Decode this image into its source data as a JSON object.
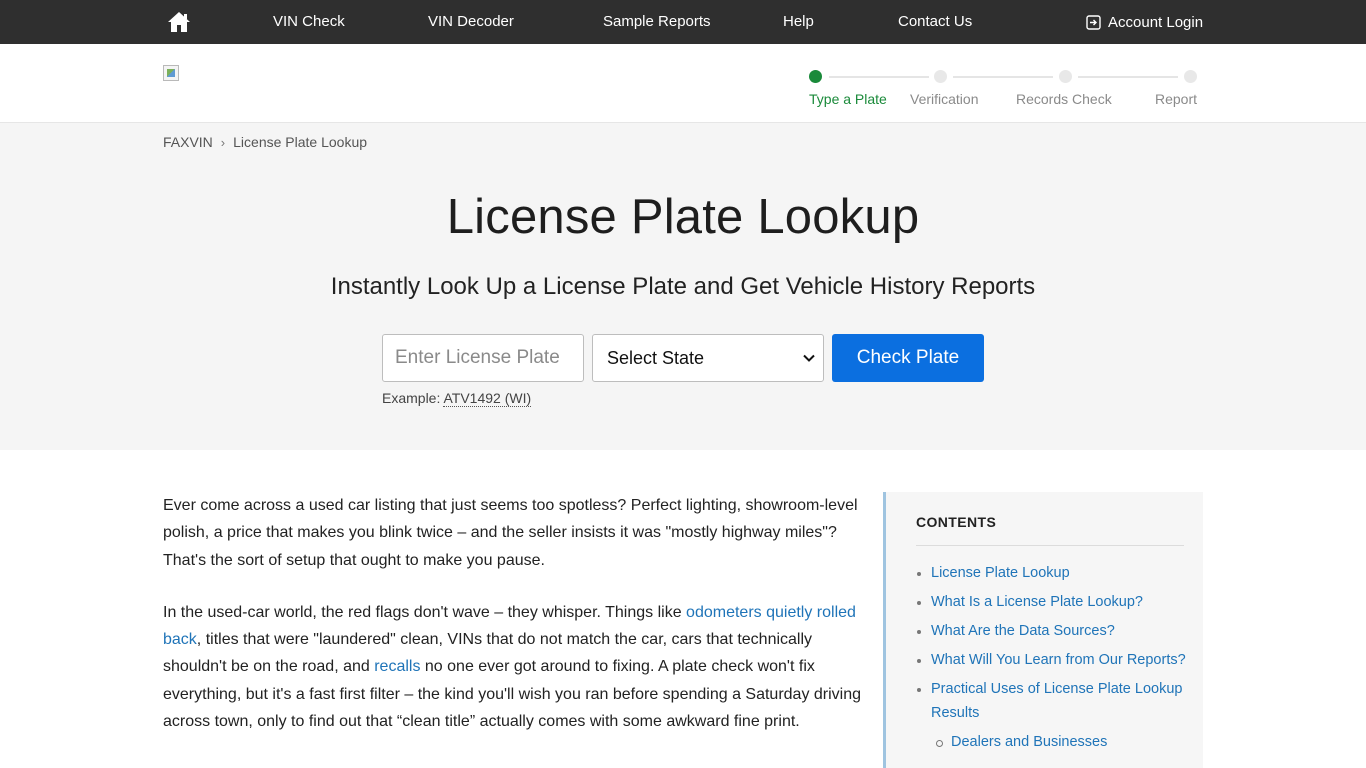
{
  "topnav": {
    "home_icon": "home-icon",
    "links": [
      "VIN Check",
      "VIN Decoder",
      "Sample Reports",
      "Help",
      "Contact Us"
    ],
    "login_icon": "login-icon",
    "login_label": "Account Login"
  },
  "header": {
    "logo_icon": "broken-image-icon",
    "steps": [
      {
        "label": "Type a Plate",
        "active": true
      },
      {
        "label": "Verification",
        "active": false
      },
      {
        "label": "Records Check",
        "active": false
      },
      {
        "label": "Report",
        "active": false
      }
    ],
    "active_color": "#1a8a3a"
  },
  "breadcrumb": {
    "items": [
      "FAXVIN",
      "License Plate Lookup"
    ],
    "separator": "›"
  },
  "hero": {
    "title": "License Plate Lookup",
    "subtitle": "Instantly Look Up a License Plate and Get Vehicle History Reports",
    "plate_placeholder": "Enter License Plate",
    "plate_value": "",
    "state_selected": "Select State",
    "button_label": "Check Plate",
    "button_color": "#0b6fe0",
    "example_prefix": "Example:",
    "example_value": "ATV1492 (WI)"
  },
  "article": {
    "p1": "Ever come across a used car listing that just seems too spotless? Perfect lighting, showroom-level polish, a price that makes you blink twice – and the seller insists it was \"mostly highway miles\"? That's the sort of setup that ought to make you pause.",
    "p2_a": "In the used-car world, the red flags don't wave – they whisper. Things like ",
    "p2_link1": "odometers quietly rolled back",
    "p2_b": ", titles that were \"laundered\" clean, VINs that do not match the car, cars that technically shouldn't be on the road, and ",
    "p2_link2": "recalls",
    "p2_c": " no one ever got around to fixing. A plate check won't fix everything, but it's a fast first filter – the kind you'll wish you ran before spending a Saturday driving across town, only to find out that “clean title” actually comes with some awkward fine print."
  },
  "toc": {
    "title": "CONTENTS",
    "items": [
      "License Plate Lookup",
      "What Is a License Plate Lookup?",
      "What Are the Data Sources?",
      "What Will You Learn from Our Reports?",
      "Practical Uses of License Plate Lookup Results"
    ],
    "sub_items": [
      "Dealers and Businesses"
    ]
  }
}
